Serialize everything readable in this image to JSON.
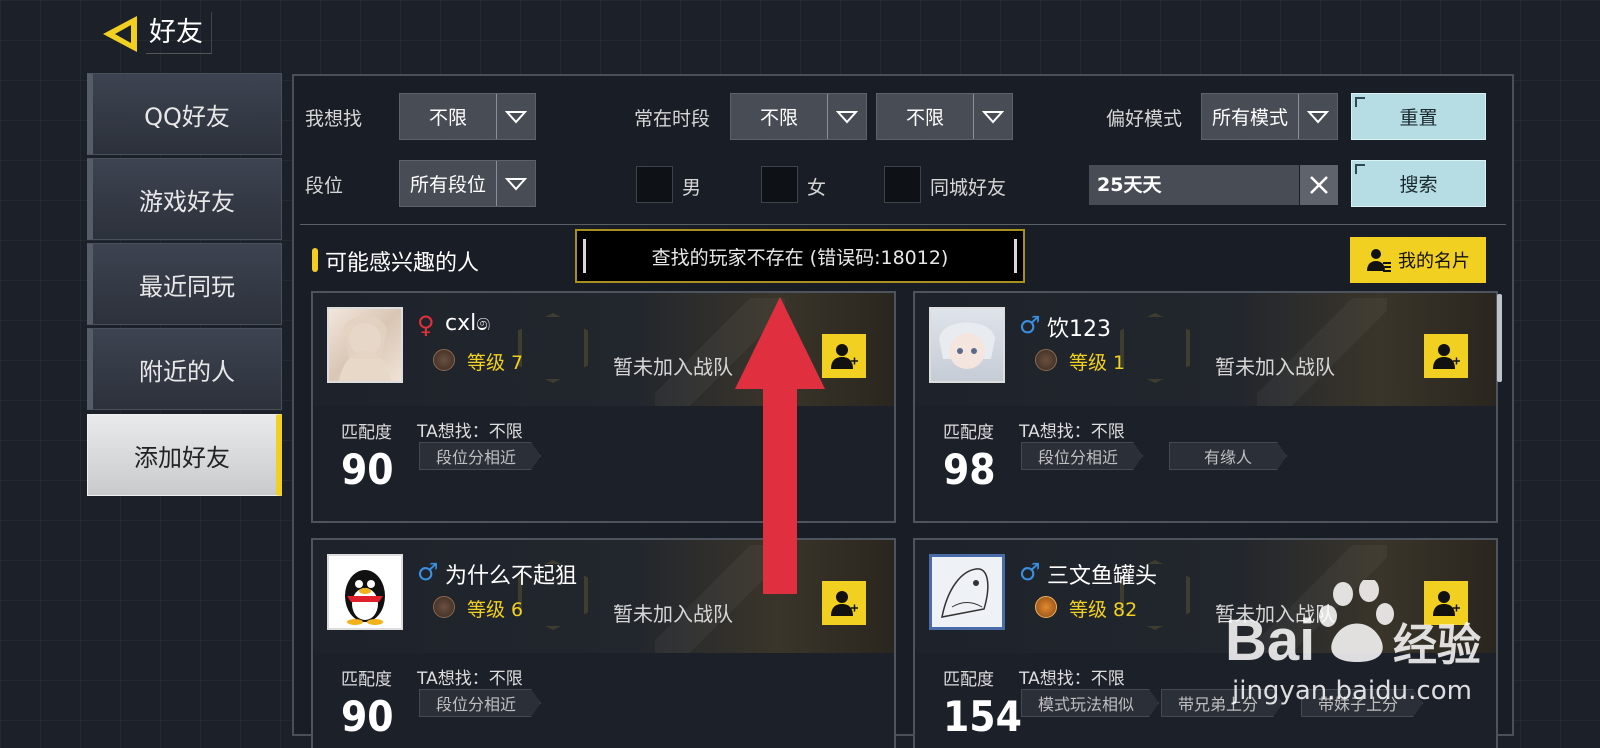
{
  "header": {
    "title": "好友"
  },
  "sidebar": {
    "items": [
      {
        "label": "QQ好友"
      },
      {
        "label": "游戏好友"
      },
      {
        "label": "最近同玩"
      },
      {
        "label": "附近的人"
      },
      {
        "label": "添加好友",
        "active": true
      }
    ]
  },
  "filters": {
    "find_label": "我想找",
    "find_value": "不限",
    "time_label": "常在时段",
    "time_value1": "不限",
    "time_value2": "不限",
    "mode_label": "偏好模式",
    "mode_value": "所有模式",
    "rank_label": "段位",
    "rank_value": "所有段位",
    "male_label": "男",
    "female_label": "女",
    "city_label": "同城好友",
    "search_value": "25天天",
    "reset_label": "重置",
    "search_label": "搜索"
  },
  "section": {
    "title": "可能感兴趣的人",
    "card_button": "我的名片"
  },
  "toast": {
    "message": "查找的玩家不存在 (错误码:18012)"
  },
  "players": [
    {
      "name": "cxl෧",
      "gender": "female",
      "gender_symbol": "♀",
      "level": "等级 7",
      "team": "暂未加入战队",
      "match_label": "匹配度",
      "score": "90",
      "ta": "TA想找：不限",
      "tags": [
        "段位分相近"
      ]
    },
    {
      "name": "饮123",
      "gender": "male",
      "gender_symbol": "♂",
      "level": "等级 1",
      "team": "暂未加入战队",
      "match_label": "匹配度",
      "score": "98",
      "ta": "TA想找：不限",
      "tags": [
        "段位分相近",
        "有缘人"
      ]
    },
    {
      "name": "为什么不起狙",
      "gender": "male",
      "gender_symbol": "♂",
      "level": "等级 6",
      "team": "暂未加入战队",
      "match_label": "匹配度",
      "score": "90",
      "ta": "TA想找：不限",
      "tags": [
        "段位分相近"
      ]
    },
    {
      "name": "三文鱼罐头",
      "gender": "male",
      "gender_symbol": "♂",
      "level": "等级 82",
      "team": "暂未加入战队",
      "match_label": "匹配度",
      "score": "154",
      "ta": "TA想找：不限",
      "tags": [
        "模式玩法相似",
        "带兄弟上分",
        "带妹子上分"
      ]
    }
  ],
  "watermark": {
    "brand": "Baidu 经验",
    "site": "jingyan.baidu.com"
  },
  "colors": {
    "accent": "#f2d021",
    "button_cyan": "#b6dde3",
    "female": "#e0303a",
    "male": "#3a8fe0",
    "annotation_arrow": "#e03040"
  }
}
